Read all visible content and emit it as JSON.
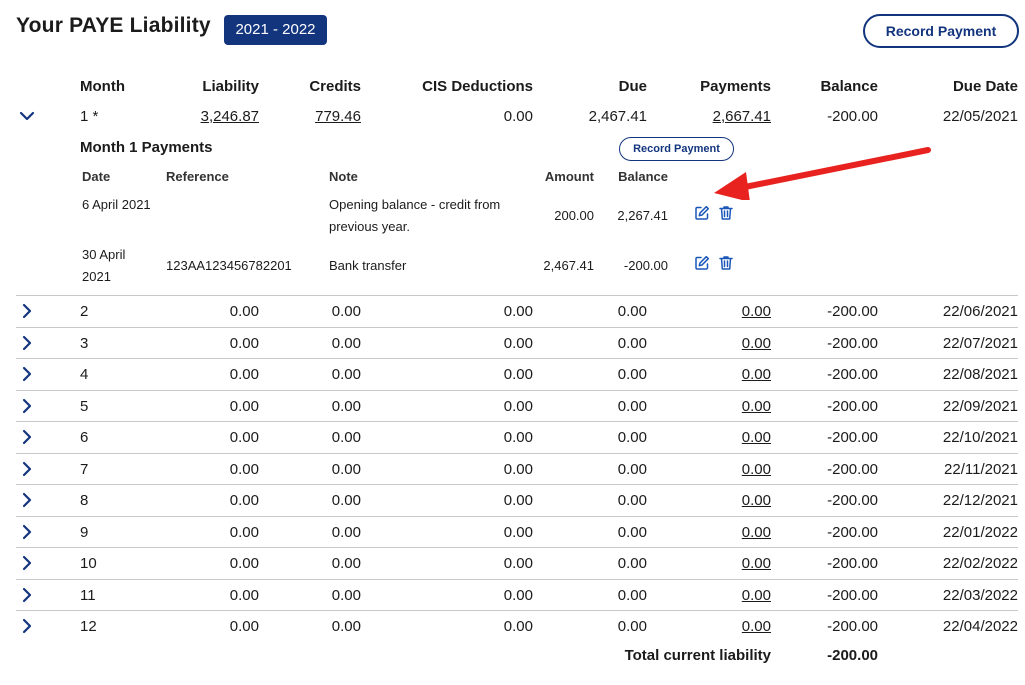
{
  "header": {
    "title": "Your PAYE Liability",
    "tax_year": "2021 - 2022",
    "record_payment_label": "Record Payment"
  },
  "columns": [
    "Month",
    "Liability",
    "Credits",
    "CIS Deductions",
    "Due",
    "Payments",
    "Balance",
    "Due Date"
  ],
  "expanded_month": {
    "month": "1 *",
    "liability": "3,246.87",
    "credits": "779.46",
    "cis": "0.00",
    "due": "2,467.41",
    "payments": "2,667.41",
    "balance": "-200.00",
    "due_date": "22/05/2021",
    "payments_title": "Month 1 Payments",
    "record_payment_label": "Record Payment",
    "payment_columns": [
      "Date",
      "Reference",
      "Note",
      "Amount",
      "Balance"
    ],
    "payments_list": [
      {
        "date": "6 April 2021",
        "reference": "",
        "note": "Opening balance - credit from previous year.",
        "amount": "200.00",
        "balance": "2,267.41"
      },
      {
        "date": "30 April 2021",
        "reference": "123AA123456782201",
        "note": "Bank transfer",
        "amount": "2,467.41",
        "balance": "-200.00"
      }
    ]
  },
  "rows": [
    {
      "month": "2",
      "liability": "0.00",
      "credits": "0.00",
      "cis": "0.00",
      "due": "0.00",
      "payments": "0.00",
      "balance": "-200.00",
      "due_date": "22/06/2021"
    },
    {
      "month": "3",
      "liability": "0.00",
      "credits": "0.00",
      "cis": "0.00",
      "due": "0.00",
      "payments": "0.00",
      "balance": "-200.00",
      "due_date": "22/07/2021"
    },
    {
      "month": "4",
      "liability": "0.00",
      "credits": "0.00",
      "cis": "0.00",
      "due": "0.00",
      "payments": "0.00",
      "balance": "-200.00",
      "due_date": "22/08/2021"
    },
    {
      "month": "5",
      "liability": "0.00",
      "credits": "0.00",
      "cis": "0.00",
      "due": "0.00",
      "payments": "0.00",
      "balance": "-200.00",
      "due_date": "22/09/2021"
    },
    {
      "month": "6",
      "liability": "0.00",
      "credits": "0.00",
      "cis": "0.00",
      "due": "0.00",
      "payments": "0.00",
      "balance": "-200.00",
      "due_date": "22/10/2021"
    },
    {
      "month": "7",
      "liability": "0.00",
      "credits": "0.00",
      "cis": "0.00",
      "due": "0.00",
      "payments": "0.00",
      "balance": "-200.00",
      "due_date": "22/11/2021"
    },
    {
      "month": "8",
      "liability": "0.00",
      "credits": "0.00",
      "cis": "0.00",
      "due": "0.00",
      "payments": "0.00",
      "balance": "-200.00",
      "due_date": "22/12/2021"
    },
    {
      "month": "9",
      "liability": "0.00",
      "credits": "0.00",
      "cis": "0.00",
      "due": "0.00",
      "payments": "0.00",
      "balance": "-200.00",
      "due_date": "22/01/2022"
    },
    {
      "month": "10",
      "liability": "0.00",
      "credits": "0.00",
      "cis": "0.00",
      "due": "0.00",
      "payments": "0.00",
      "balance": "-200.00",
      "due_date": "22/02/2022"
    },
    {
      "month": "11",
      "liability": "0.00",
      "credits": "0.00",
      "cis": "0.00",
      "due": "0.00",
      "payments": "0.00",
      "balance": "-200.00",
      "due_date": "22/03/2022"
    },
    {
      "month": "12",
      "liability": "0.00",
      "credits": "0.00",
      "cis": "0.00",
      "due": "0.00",
      "payments": "0.00",
      "balance": "-200.00",
      "due_date": "22/04/2022"
    }
  ],
  "footer": {
    "total_label": "Total current liability",
    "total_value": "-200.00"
  },
  "colors": {
    "brand_navy": "#13357e",
    "icon_blue": "#1a56b8",
    "annotation_red": "#e8231f"
  },
  "icons": {
    "expand": "chevron-right-icon",
    "collapse": "chevron-down-icon",
    "edit": "edit-icon",
    "delete": "trash-icon"
  }
}
